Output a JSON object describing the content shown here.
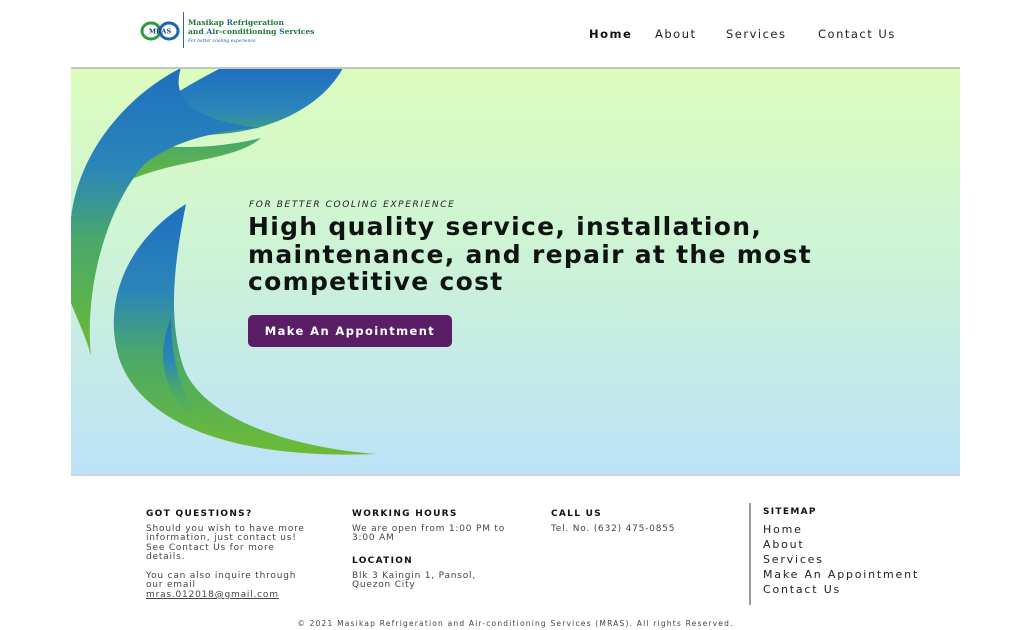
{
  "brand": {
    "logo_mark": "MRAS",
    "name_line1_a": "Masikap ",
    "name_line1_b": "R",
    "name_line1_c": "efrigeration",
    "name_line2_a": "and ",
    "name_line2_b": "A",
    "name_line2_c": "ir-conditioning ",
    "name_line2_d": "S",
    "name_line2_e": "ervices",
    "tagline": "For better cooling experience",
    "colors": {
      "green": "#1e7a3a",
      "blue": "#1a64b0"
    }
  },
  "nav": {
    "items": [
      {
        "label": "Home",
        "active": true
      },
      {
        "label": "About",
        "active": false
      },
      {
        "label": "Services",
        "active": false
      },
      {
        "label": "Contact Us",
        "active": false
      }
    ]
  },
  "hero": {
    "tagline": "FOR BETTER COOLING EXPERIENCE",
    "headline_line1": "High quality service, installation,",
    "headline_line2": "maintenance, and repair at the most",
    "headline_line3": "competitive cost",
    "cta_label": "Make An Appointment",
    "colors": {
      "cta": "#5a1e66",
      "gradient_top": "#dcfdbd",
      "gradient_bottom": "#bde2f9",
      "swoosh_blue": "#1f6fc0",
      "swoosh_green": "#5cb23c"
    }
  },
  "footer": {
    "questions": {
      "heading": "GOT QUESTIONS?",
      "text_line1": "Should you wish to have more",
      "text_line2": "information, just contact us!",
      "text_line3": "See Contact Us for more",
      "text_line4": "details.",
      "inquire_line1": "You can also inquire through",
      "inquire_line2": "our email",
      "email": "mras.012018@gmail.com"
    },
    "hours": {
      "heading": "WORKING HOURS",
      "text_line1": "We are open from 1:00 PM to",
      "text_line2": "3:00 AM"
    },
    "location": {
      "heading": "LOCATION",
      "text_line1": "Blk 3 Kaingin 1, Pansol,",
      "text_line2": "Quezon City"
    },
    "call": {
      "heading": "CALL US",
      "text": "Tel. No. (632) 475-0855"
    },
    "sitemap": {
      "heading": "SITEMAP",
      "items": [
        "Home",
        "About",
        "Services",
        "Make An Appointment",
        "Contact Us"
      ]
    },
    "copyright": "© 2021 Masikap Refrigeration and Air-conditioning Services (MRAS). All rights Reserved."
  }
}
